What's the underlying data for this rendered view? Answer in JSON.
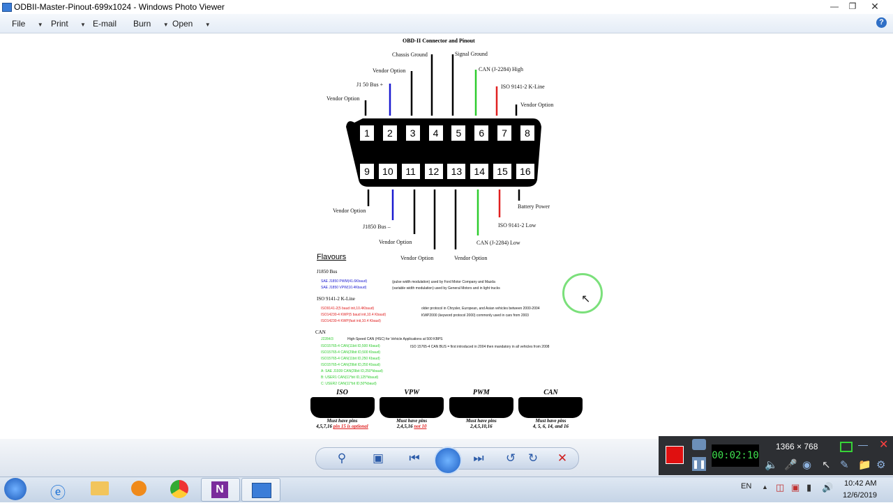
{
  "window": {
    "title": "ODBII-Master-Pinout-699x1024 - Windows Photo Viewer"
  },
  "menu": {
    "file": "File",
    "print": "Print",
    "email": "E-mail",
    "burn": "Burn",
    "open": "Open",
    "help": "?"
  },
  "document": {
    "title": "OBD-II Connector and Pinout",
    "pins_top": [
      "1",
      "2",
      "3",
      "4",
      "5",
      "6",
      "7",
      "8"
    ],
    "pins_bottom": [
      "9",
      "10",
      "11",
      "12",
      "13",
      "14",
      "15",
      "16"
    ],
    "labels_top": {
      "p1": "Vendor Option",
      "p2": "J1  50 Bus +",
      "p3": "Vendor Option",
      "p4": "Chassis Ground",
      "p5": "Signal Ground",
      "p6": "CAN (J-2284) High",
      "p7": "ISO 9141-2 K-Line",
      "p8": "Vendor Option"
    },
    "labels_bottom": {
      "p9": "Vendor Option",
      "p10": "J1850 Bus –",
      "p11": "Vendor Option",
      "p12": "Vendor Option",
      "p13": "Vendor Option",
      "p14": "CAN (J-2284) Low",
      "p15": "ISO 9141-2 Low",
      "p16": "Battery Power"
    },
    "flavours_heading": "Flavours",
    "j1850": {
      "heading": "J1850 Bus",
      "items": [
        "SAE J1850 PWM(41.6Kbaud)",
        "SAE J1850 VPW(10.4Kbaud)"
      ],
      "notes": [
        "(pulse width modulation) used by Ford Motor Company and Mazda",
        "(variable width modulation) used by General Motors and in light trucks"
      ]
    },
    "iso": {
      "heading": "ISO 9141-2 K-Line",
      "items": [
        "ISO9141-2(5 baud init,10.4Kbaud)",
        "ISO14230-4 KWP(5 baud init,10.4 Kbaud)",
        "ISO14230-4 KWP(fast init,10.4 Kbaud)"
      ],
      "notes": [
        "older protocol in Chrysler, European, and Asian vehicles between 2000-2004",
        "KWP2000 (keyword protocol 2000) commonly used in cars from 2003"
      ]
    },
    "can": {
      "heading": "CAN",
      "j2284": "J2284/3",
      "j2284_note": "High-Speed CAN (HSC) for Vehicle Applications at 500 KBPS",
      "items": [
        "ISO15765-4 CAN(11bit ID,500 Kbaud)",
        "ISO15765-4 CAN(29bit ID,500 Kbaud)",
        "ISO15765-4 CAN(11bit ID,250 Kbaud)",
        "ISO15765-4 CAN(29bit ID,250 Kbaud)",
        "A: SAE J1939 CAN(29bit ID,250*kbaud)",
        "B: USER1 CAN(11*bit ID,125*kbaud)",
        "C: USER2 CAN(11*bit ID,50*kbaud)"
      ],
      "note": "ISO 15765-4 CAN BUS = first introduced in 2004 then mandatory in all vehicles from 2008"
    },
    "connectors": [
      {
        "name": "ISO",
        "must": "Must have pins",
        "pins": "4,5,7,16",
        "extra": "pin 15 is optional"
      },
      {
        "name": "VPW",
        "must": "Must have pins",
        "pins": "2,4,5,16",
        "extra": "not 10"
      },
      {
        "name": "PWM",
        "must": "Must have pins",
        "pins": "2,4,5,10,16",
        "extra": ""
      },
      {
        "name": "CAN",
        "must": "Must have pins",
        "pins": "4, 5, 6, 14, and 16",
        "extra": ""
      }
    ]
  },
  "recorder": {
    "timer": "00:02:10",
    "resolution": "1366 × 768"
  },
  "taskbar": {
    "lang": "EN",
    "time": "10:42 AM",
    "date": "12/6/2019"
  },
  "colors": {
    "can": "#2ecc2e",
    "iso": "#e02020",
    "j1850": "#1a1ad0",
    "menubg": "#e8eef6"
  }
}
